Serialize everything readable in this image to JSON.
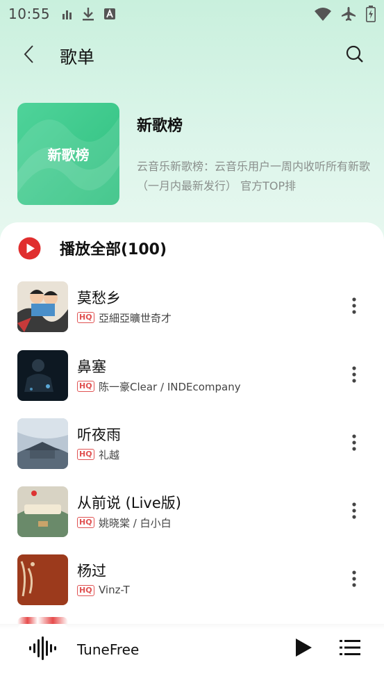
{
  "status_bar": {
    "time": "10:55",
    "left_icons": [
      "signal-bars-icon",
      "download-icon",
      "a-box-icon"
    ],
    "right_icons": [
      "wifi-icon",
      "airplane-icon",
      "battery-charging-icon"
    ]
  },
  "header": {
    "title": "歌单"
  },
  "playlist": {
    "cover_text": "新歌榜",
    "name": "新歌榜",
    "description": "云音乐新歌榜：云音乐用户一周内收听所有新歌（一月内最新发行） 官方TOP排",
    "cover_colors": [
      "#4fd39a",
      "#2fc07f"
    ]
  },
  "play_all": {
    "label": "播放全部(100)"
  },
  "songs": [
    {
      "title": "莫愁乡",
      "badge": "HQ",
      "artist": "亞細亞曠世奇才"
    },
    {
      "title": "鼻塞",
      "badge": "HQ",
      "artist": "陈一豪Clear / INDEcompany"
    },
    {
      "title": "听夜雨",
      "badge": "HQ",
      "artist": "礼越"
    },
    {
      "title": "从前说 (Live版)",
      "badge": "HQ",
      "artist": "姚晓棠 / 白小白"
    },
    {
      "title": "杨过",
      "badge": "HQ",
      "artist": "Vinz-T"
    }
  ],
  "player": {
    "title": "TuneFree"
  },
  "colors": {
    "accent_red": "#e02e2e",
    "hq_red": "#e05252",
    "header_green": "#c9f0dd"
  }
}
